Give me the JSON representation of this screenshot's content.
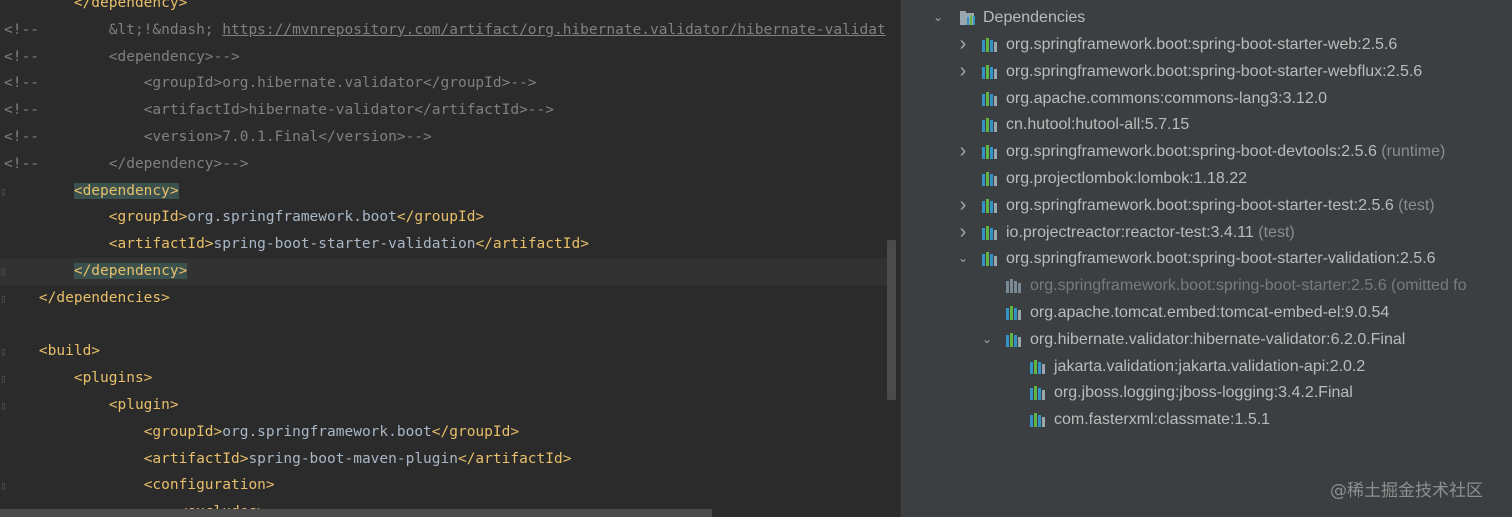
{
  "editor": {
    "comment_prefix": "<!--",
    "lines": [
      {
        "id": "l0",
        "fold": false,
        "comment": false,
        "indent": "        ",
        "parts": [
          {
            "c": "t-tag",
            "t": "</dependency>"
          }
        ]
      },
      {
        "id": "l1",
        "fold": false,
        "comment": true,
        "indent": "            ",
        "parts": [
          {
            "c": "t-comment",
            "t": "&lt;!&ndash; "
          },
          {
            "c": "t-link",
            "t": "https://mvnrepository.com/artifact/org.hibernate.validator/hibernate-validat"
          }
        ]
      },
      {
        "id": "l2",
        "fold": false,
        "comment": true,
        "indent": "            ",
        "parts": [
          {
            "c": "t-comment",
            "t": "<dependency>-->"
          }
        ]
      },
      {
        "id": "l3",
        "fold": false,
        "comment": true,
        "indent": "                ",
        "parts": [
          {
            "c": "t-comment",
            "t": "<groupId>org.hibernate.validator</groupId>-->"
          }
        ]
      },
      {
        "id": "l4",
        "fold": false,
        "comment": true,
        "indent": "                ",
        "parts": [
          {
            "c": "t-comment",
            "t": "<artifactId>hibernate-validator</artifactId>-->"
          }
        ]
      },
      {
        "id": "l5",
        "fold": false,
        "comment": true,
        "indent": "                ",
        "parts": [
          {
            "c": "t-comment",
            "t": "<version>7.0.1.Final</version>-->"
          }
        ]
      },
      {
        "id": "l6",
        "fold": false,
        "comment": true,
        "indent": "            ",
        "parts": [
          {
            "c": "t-comment",
            "t": "</dependency>-->"
          }
        ]
      },
      {
        "id": "l7",
        "fold": true,
        "comment": false,
        "indent": "        ",
        "parts": [
          {
            "c": "t-tag hl",
            "t": "<dependency>"
          }
        ]
      },
      {
        "id": "l8",
        "fold": false,
        "comment": false,
        "indent": "            ",
        "parts": [
          {
            "c": "t-tag",
            "t": "<groupId>"
          },
          {
            "c": "t-text",
            "t": "org.springframework.boot"
          },
          {
            "c": "t-tag",
            "t": "</groupId>"
          }
        ]
      },
      {
        "id": "l9",
        "fold": false,
        "comment": false,
        "indent": "            ",
        "parts": [
          {
            "c": "t-tag",
            "t": "<artifactId>"
          },
          {
            "c": "t-text",
            "t": "spring-boot-starter-validation"
          },
          {
            "c": "t-tag",
            "t": "</artifactId>"
          }
        ]
      },
      {
        "id": "l10",
        "fold": true,
        "comment": false,
        "indent": "        ",
        "current": true,
        "parts": [
          {
            "c": "t-tag hl",
            "t": "</dependency>"
          }
        ]
      },
      {
        "id": "l11",
        "fold": true,
        "comment": false,
        "indent": "    ",
        "parts": [
          {
            "c": "t-tag",
            "t": "</dependencies>"
          }
        ]
      },
      {
        "id": "l12",
        "fold": false,
        "comment": false,
        "indent": "",
        "parts": []
      },
      {
        "id": "l13",
        "fold": true,
        "comment": false,
        "indent": "    ",
        "parts": [
          {
            "c": "t-tag",
            "t": "<build>"
          }
        ]
      },
      {
        "id": "l14",
        "fold": true,
        "comment": false,
        "indent": "        ",
        "parts": [
          {
            "c": "t-tag",
            "t": "<plugins>"
          }
        ]
      },
      {
        "id": "l15",
        "fold": true,
        "comment": false,
        "indent": "            ",
        "parts": [
          {
            "c": "t-tag",
            "t": "<plugin>"
          }
        ]
      },
      {
        "id": "l16",
        "fold": false,
        "comment": false,
        "indent": "                ",
        "parts": [
          {
            "c": "t-tag",
            "t": "<groupId>"
          },
          {
            "c": "t-text",
            "t": "org.springframework.boot"
          },
          {
            "c": "t-tag",
            "t": "</groupId>"
          }
        ]
      },
      {
        "id": "l17",
        "fold": false,
        "comment": false,
        "indent": "                ",
        "parts": [
          {
            "c": "t-tag",
            "t": "<artifactId>"
          },
          {
            "c": "t-text",
            "t": "spring-boot-maven-plugin"
          },
          {
            "c": "t-tag",
            "t": "</artifactId>"
          }
        ]
      },
      {
        "id": "l18",
        "fold": true,
        "comment": false,
        "indent": "                ",
        "parts": [
          {
            "c": "t-tag",
            "t": "<configuration>"
          }
        ]
      },
      {
        "id": "l19",
        "fold": true,
        "comment": false,
        "indent": "                    ",
        "parts": [
          {
            "c": "t-tag",
            "t": "<excludes>"
          }
        ]
      }
    ]
  },
  "maven": {
    "dependencies_label": "Dependencies",
    "items": [
      {
        "label": "org.springframework.boot:spring-boot-starter-web:2.5.6",
        "scope": "",
        "arrow": "right",
        "depth": 1
      },
      {
        "label": "org.springframework.boot:spring-boot-starter-webflux:2.5.6",
        "scope": "",
        "arrow": "right",
        "depth": 1
      },
      {
        "label": "org.apache.commons:commons-lang3:3.12.0",
        "scope": "",
        "arrow": "none",
        "depth": 1
      },
      {
        "label": "cn.hutool:hutool-all:5.7.15",
        "scope": "",
        "arrow": "none",
        "depth": 1
      },
      {
        "label": "org.springframework.boot:spring-boot-devtools:2.5.6",
        "scope": "(runtime)",
        "arrow": "right",
        "depth": 1
      },
      {
        "label": "org.projectlombok:lombok:1.18.22",
        "scope": "",
        "arrow": "none",
        "depth": 1
      },
      {
        "label": "org.springframework.boot:spring-boot-starter-test:2.5.6",
        "scope": "(test)",
        "arrow": "right",
        "depth": 1
      },
      {
        "label": "io.projectreactor:reactor-test:3.4.11",
        "scope": "(test)",
        "arrow": "right",
        "depth": 1
      },
      {
        "label": "org.springframework.boot:spring-boot-starter-validation:2.5.6",
        "scope": "",
        "arrow": "down",
        "depth": 1
      },
      {
        "label": "org.springframework.boot:spring-boot-starter:2.5.6 (omitted fo",
        "scope": "",
        "arrow": "none",
        "depth": 2,
        "omitted": true
      },
      {
        "label": "org.apache.tomcat.embed:tomcat-embed-el:9.0.54",
        "scope": "",
        "arrow": "none",
        "depth": 2
      },
      {
        "label": "org.hibernate.validator:hibernate-validator:6.2.0.Final",
        "scope": "",
        "arrow": "down",
        "depth": 2
      },
      {
        "label": "jakarta.validation:jakarta.validation-api:2.0.2",
        "scope": "",
        "arrow": "none",
        "depth": 3
      },
      {
        "label": "org.jboss.logging:jboss-logging:3.4.2.Final",
        "scope": "",
        "arrow": "none",
        "depth": 3
      },
      {
        "label": "com.fasterxml:classmate:1.5.1",
        "scope": "",
        "arrow": "none",
        "depth": 3
      }
    ]
  },
  "watermark": "@稀土掘金技术社区",
  "icons": {
    "library": "library-icon",
    "dependencies": "dependencies-folder-icon",
    "expand": "chevron-right-icon",
    "collapse": "chevron-down-icon"
  }
}
